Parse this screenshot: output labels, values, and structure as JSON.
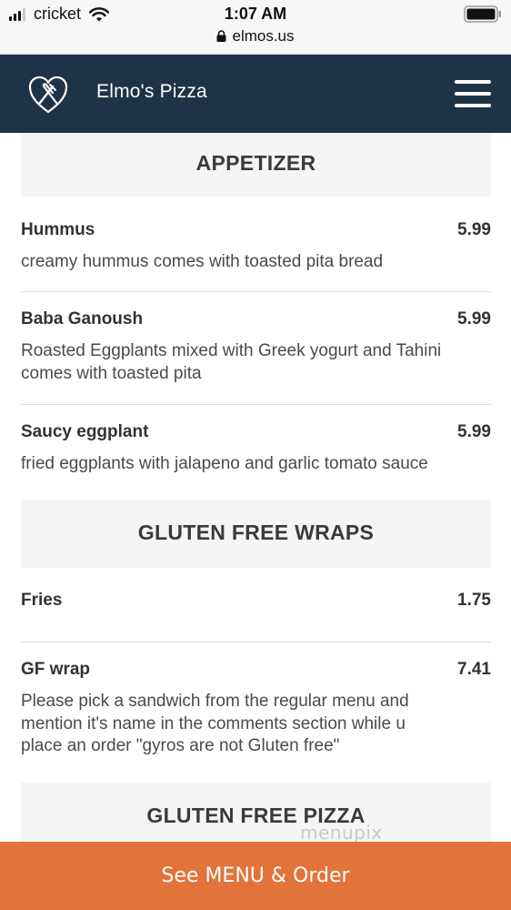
{
  "status_bar": {
    "carrier": "cricket",
    "time": "1:07 AM",
    "url": "elmos.us"
  },
  "header": {
    "brand": "Elmo's Pizza",
    "logo_icon": "fork-knife-icon",
    "menu_icon": "hamburger-menu-icon"
  },
  "sections": [
    {
      "title": "APPETIZER",
      "items": [
        {
          "name": "Hummus",
          "price": "5.99",
          "desc_lines": [
            "creamy hummus comes with toasted pita bread"
          ]
        },
        {
          "name": "Baba Ganoush",
          "price": "5.99",
          "desc_lines": [
            "Roasted Eggplants mixed with Greek yogurt and Tahini",
            "comes with toasted pita"
          ]
        },
        {
          "name": "Saucy eggplant",
          "price": "5.99",
          "desc_lines": [
            "fried eggplants with jalapeno and garlic tomato sauce"
          ]
        }
      ]
    },
    {
      "title": "GLUTEN FREE WRAPS",
      "items": [
        {
          "name": "Fries",
          "price": "1.75",
          "desc_lines": []
        },
        {
          "name": "GF wrap",
          "price": "7.41",
          "desc_lines": [
            "Please pick a sandwich from the regular menu and",
            "mention it's name in the comments section while u",
            "place an order \"gyros are not Gluten free\""
          ]
        }
      ]
    },
    {
      "title": "GLUTEN FREE PIZZA",
      "items": []
    }
  ],
  "watermark": "menupix",
  "cta": {
    "label": "See MENU & Order"
  },
  "colors": {
    "header_bg": "#1d3347",
    "cta_bg": "#e2733a",
    "section_bg": "#f5f5f5"
  }
}
